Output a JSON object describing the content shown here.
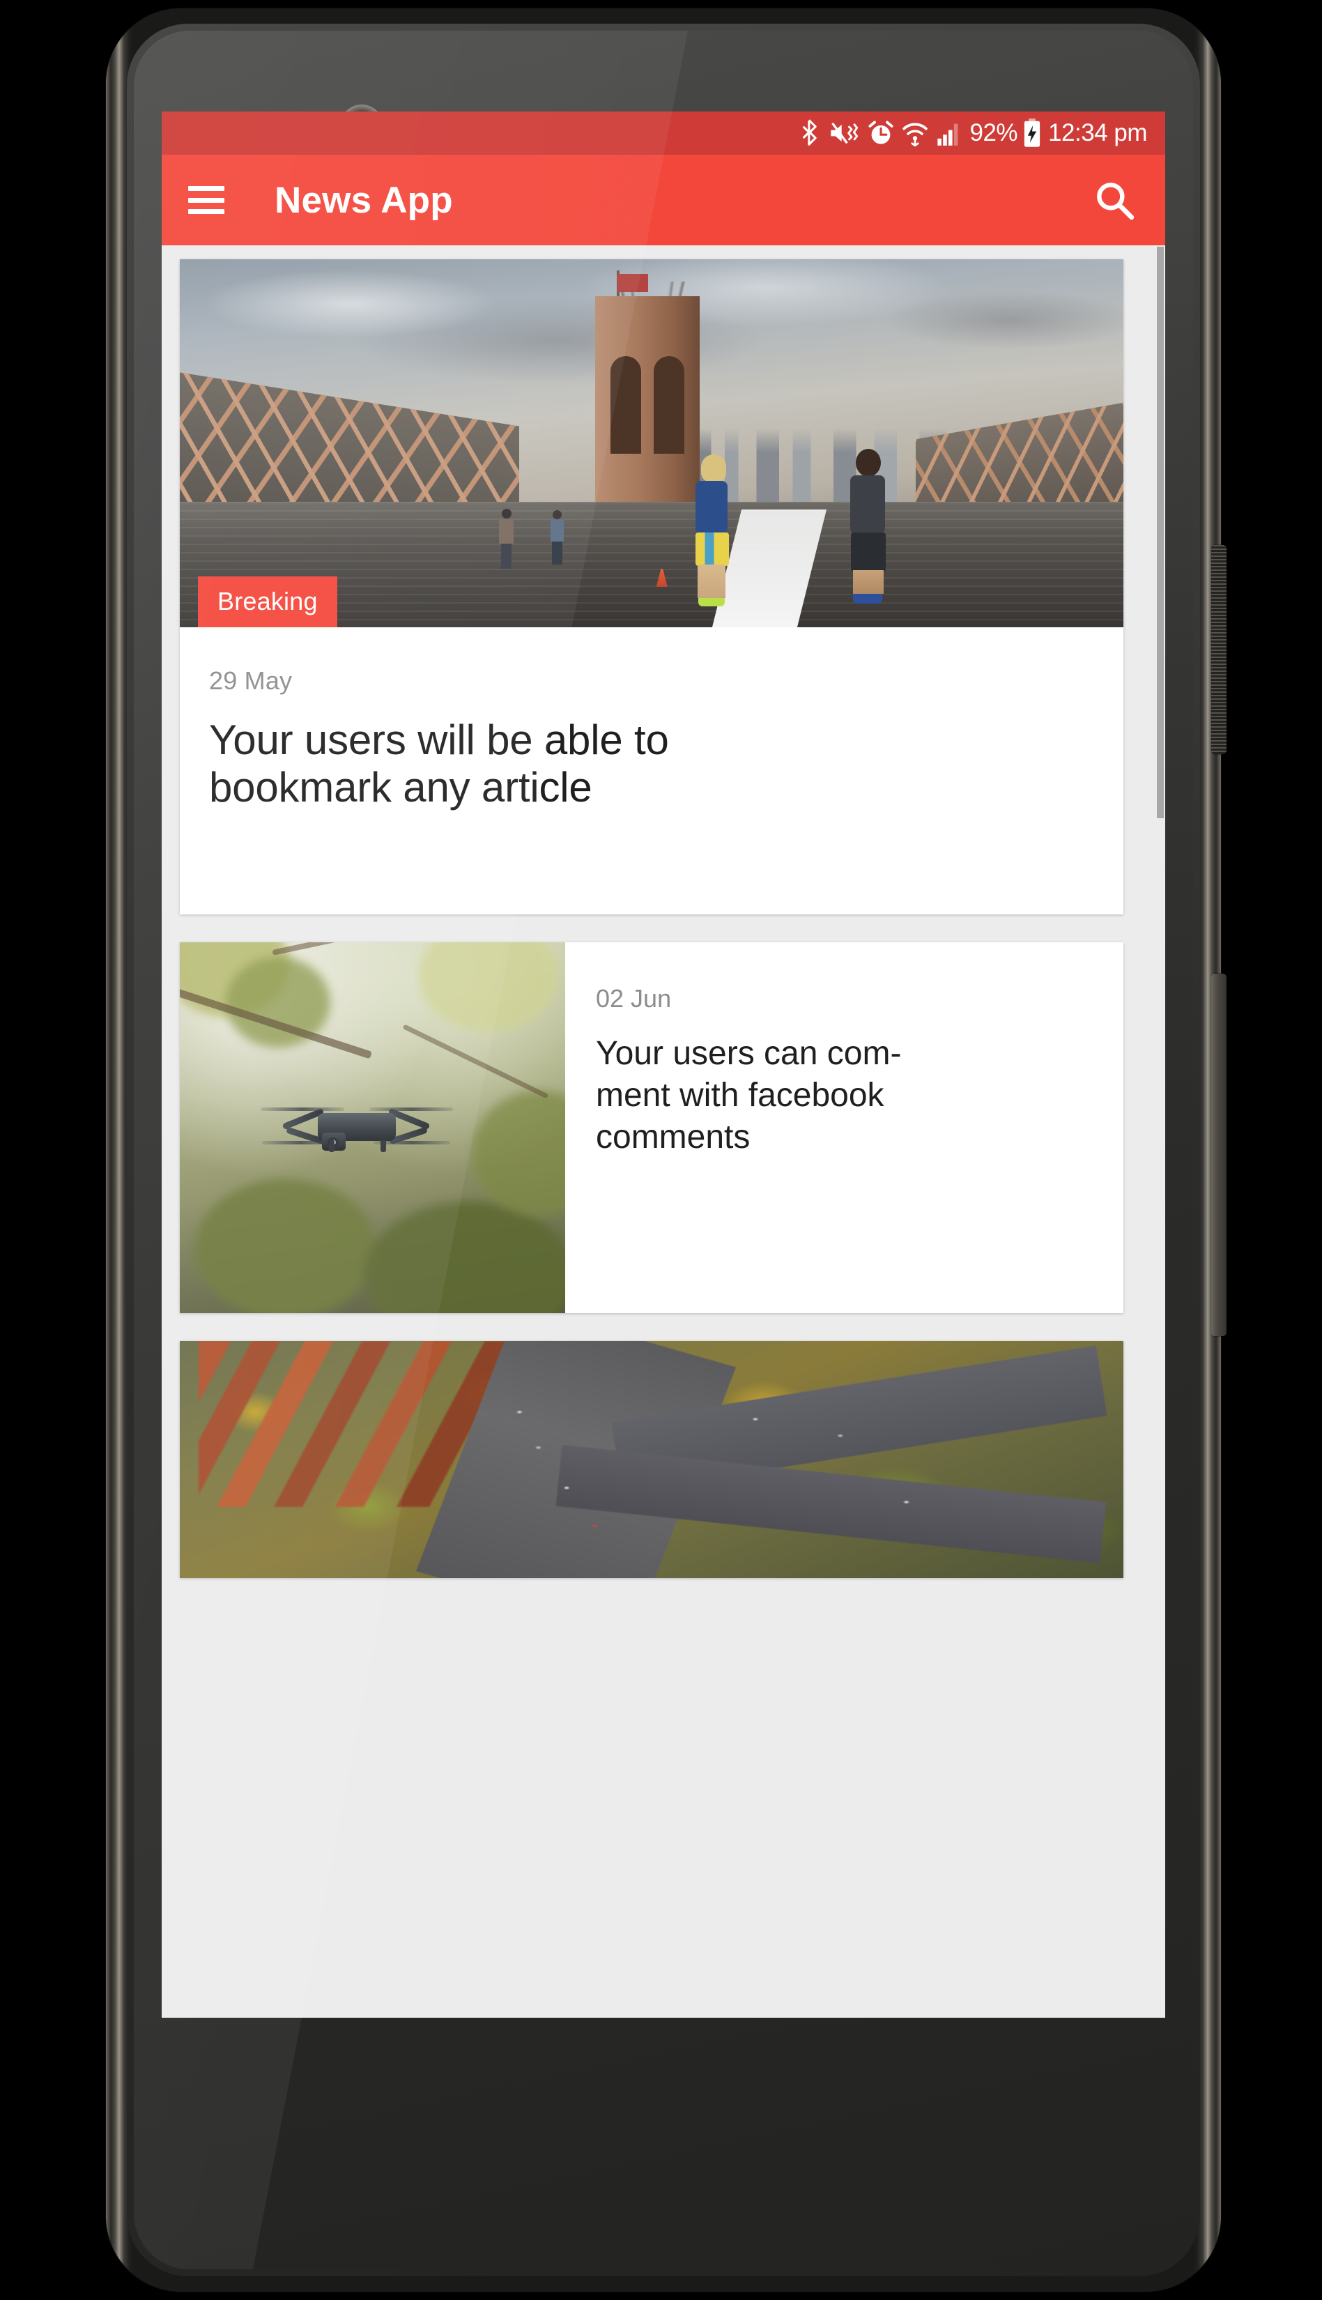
{
  "device": {
    "name": "android-phone-mockup",
    "hardware": {
      "front_camera": "camera-icon",
      "earpiece_speaker": "speaker-grille",
      "proximity_sensor": "sensor",
      "power_button": "power-button",
      "volume_button": "volume-rocker"
    }
  },
  "colors": {
    "status_bar": "#cf3b36",
    "app_bar": "#f4473b",
    "badge": "#f4473b",
    "page_background": "#ececec",
    "card_background": "#ffffff",
    "title_text": "#1f1f1f",
    "meta_text": "#8c8c8c",
    "on_primary": "#ffffff"
  },
  "status_bar": {
    "icons": [
      "bluetooth-icon",
      "mute-vibrate-icon",
      "alarm-clock-icon",
      "wifi-icon",
      "cell-signal-icon"
    ],
    "battery_percent": "92%",
    "battery_state": "charging-battery-icon",
    "time": "12:34 pm"
  },
  "app_bar": {
    "menu_icon": "hamburger-menu-icon",
    "title": "News App",
    "search_icon": "search-icon"
  },
  "feed": {
    "scrollbar": "vertical-scrollbar",
    "articles": [
      {
        "layout": "hero",
        "badge": "Breaking",
        "date": "29 May",
        "title": "Your users will be able to bookmark any article",
        "title_line_1": "Your users will be able to",
        "title_line_2": "bookmark any article",
        "image": "joggers-on-brooklyn-bridge-photo"
      },
      {
        "layout": "row",
        "badge": "",
        "date": "02 Jun",
        "title": "Your users can comment with facebook comments",
        "title_line_1": "Your users can com-",
        "title_line_2": "ment with facebook",
        "title_line_3": "comments",
        "image": "quadcopter-drone-photo"
      },
      {
        "layout": "image-only",
        "badge": "",
        "date": "",
        "title": "",
        "image": "aerial-highway-interchange-photo"
      }
    ]
  }
}
